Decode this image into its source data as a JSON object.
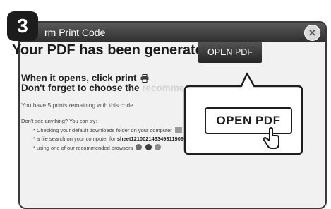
{
  "step": {
    "number": "3"
  },
  "dialog": {
    "title": "rm Print Code",
    "close_symbol": "✕",
    "headline": "Your PDF has been generated!",
    "open_button_label": "OPEN PDF",
    "instruction1": "When it opens, click print",
    "instruction2_prefix": "Don't forget to choose the ",
    "instruction2_faded": "recomme",
    "remaining_text": "You have 5 prints remaining with this code.",
    "dont_see": "Don't see anything? You can try:",
    "tip1": "* Checking your default downloads folder on your computer",
    "tip2_prefix": "* a file search on your computer for ",
    "tip2_filename": "sheet1210021433493119090.pdf",
    "tip3": "* using one of our recommended browsers"
  },
  "callout": {
    "button_label": "OPEN PDF"
  },
  "icons": [
    "printer-icon",
    "folder-icon",
    "ie-browser-icon",
    "firefox-browser-icon",
    "chrome-browser-icon",
    "cursor-icon"
  ]
}
